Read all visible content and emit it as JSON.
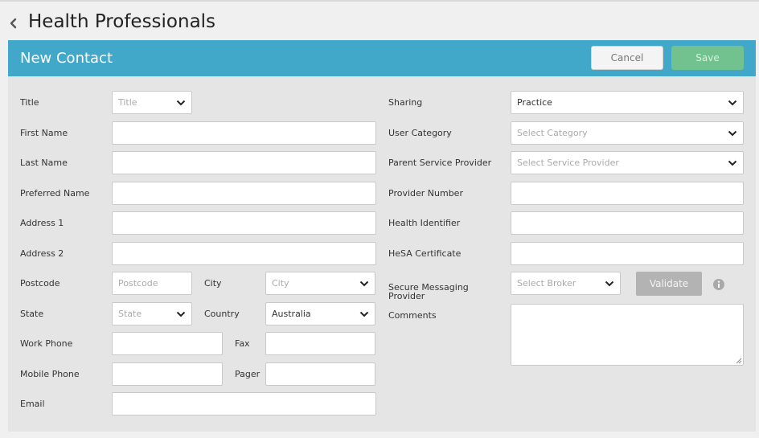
{
  "page": {
    "title": "Health Professionals"
  },
  "panel": {
    "title": "New Contact",
    "cancel_label": "Cancel",
    "save_label": "Save"
  },
  "left": {
    "title": {
      "label": "Title",
      "placeholder": "Title"
    },
    "first_name": {
      "label": "First Name",
      "value": ""
    },
    "last_name": {
      "label": "Last Name",
      "value": ""
    },
    "preferred_name": {
      "label": "Preferred Name",
      "value": ""
    },
    "address1": {
      "label": "Address 1",
      "value": ""
    },
    "address2": {
      "label": "Address 2",
      "value": ""
    },
    "postcode": {
      "label": "Postcode",
      "placeholder": "Postcode"
    },
    "city": {
      "label": "City",
      "placeholder": "City"
    },
    "state": {
      "label": "State",
      "placeholder": "State"
    },
    "country": {
      "label": "Country",
      "value": "Australia"
    },
    "work_phone": {
      "label": "Work Phone",
      "value": ""
    },
    "fax": {
      "label": "Fax",
      "value": ""
    },
    "mobile_phone": {
      "label": "Mobile Phone",
      "value": ""
    },
    "pager": {
      "label": "Pager",
      "value": ""
    },
    "email": {
      "label": "Email",
      "value": ""
    }
  },
  "right": {
    "sharing": {
      "label": "Sharing",
      "value": "Practice"
    },
    "user_category": {
      "label": "User Category",
      "placeholder": "Select Category"
    },
    "parent_service_provider": {
      "label": "Parent Service Provider",
      "placeholder": "Select Service Provider"
    },
    "provider_number": {
      "label": "Provider Number",
      "value": ""
    },
    "health_identifier": {
      "label": "Health Identifier",
      "value": ""
    },
    "hesa_certificate": {
      "label": "HeSA Certificate",
      "value": ""
    },
    "secure_messaging": {
      "label": "Secure Messaging Provider",
      "placeholder": "Select Broker",
      "validate_label": "Validate"
    },
    "comments": {
      "label": "Comments",
      "value": ""
    }
  },
  "icons": {
    "back": "chevron-left-icon",
    "dropdown": "chevron-down-icon",
    "info": "info-icon",
    "resize": "resize-grip-icon"
  },
  "colors": {
    "header_bar": "#42a8c9",
    "save_button": "#71c28e",
    "validate_button": "#b3b3b3",
    "panel_bg": "#e5e5e5"
  }
}
